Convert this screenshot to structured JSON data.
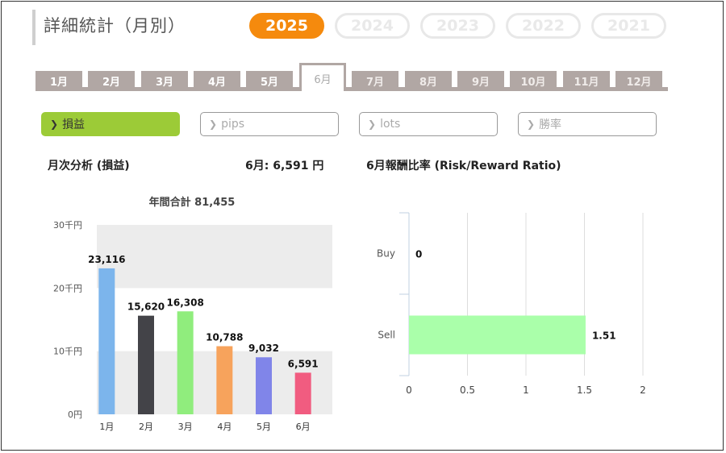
{
  "page_title": "詳細統計（月別）",
  "years": [
    {
      "label": "2025",
      "active": true
    },
    {
      "label": "2024",
      "active": false
    },
    {
      "label": "2023",
      "active": false
    },
    {
      "label": "2022",
      "active": false
    },
    {
      "label": "2021",
      "active": false
    }
  ],
  "months": [
    "1月",
    "2月",
    "3月",
    "4月",
    "5月",
    "6月",
    "7月",
    "8月",
    "9月",
    "10月",
    "11月",
    "12月"
  ],
  "active_month_index": 5,
  "filters": [
    {
      "label": "損益",
      "active": true
    },
    {
      "label": "pips",
      "active": false
    },
    {
      "label": "lots",
      "active": false
    },
    {
      "label": "勝率",
      "active": false
    }
  ],
  "left_panel": {
    "heading": "月次分析 (損益)",
    "month_total": "6月:  6,591 円"
  },
  "right_panel": {
    "heading": "6月報酬比率 (Risk/Reward Ratio)"
  },
  "chart_data": [
    {
      "type": "bar",
      "title": "年間合計 81,455",
      "categories": [
        "1月",
        "2月",
        "3月",
        "4月",
        "5月",
        "6月"
      ],
      "values": [
        23116,
        15620,
        16308,
        10788,
        9032,
        6591
      ],
      "value_labels": [
        "23,116",
        "15,620",
        "16,308",
        "10,788",
        "9,032",
        "6,591"
      ],
      "colors": [
        "#7cb5ec",
        "#434348",
        "#90ed7d",
        "#f7a35c",
        "#8085e9",
        "#f15c80"
      ],
      "ylim": [
        0,
        30000
      ],
      "yticks": [
        0,
        10000,
        20000,
        30000
      ],
      "ytick_labels": [
        "0円",
        "10千円",
        "20千円",
        "30千円"
      ],
      "grid": "alternating bands"
    },
    {
      "type": "bar",
      "orientation": "horizontal",
      "categories": [
        "Buy",
        "Sell"
      ],
      "values": [
        0,
        1.51
      ],
      "value_labels": [
        "0",
        "1.51"
      ],
      "color": "#aaffaa",
      "xlim": [
        0,
        2
      ],
      "xticks": [
        0,
        0.5,
        1,
        1.5,
        2
      ],
      "xtick_labels": [
        "0",
        "0.5",
        "1",
        "1.5",
        "2"
      ],
      "grid": "vertical lines"
    }
  ]
}
